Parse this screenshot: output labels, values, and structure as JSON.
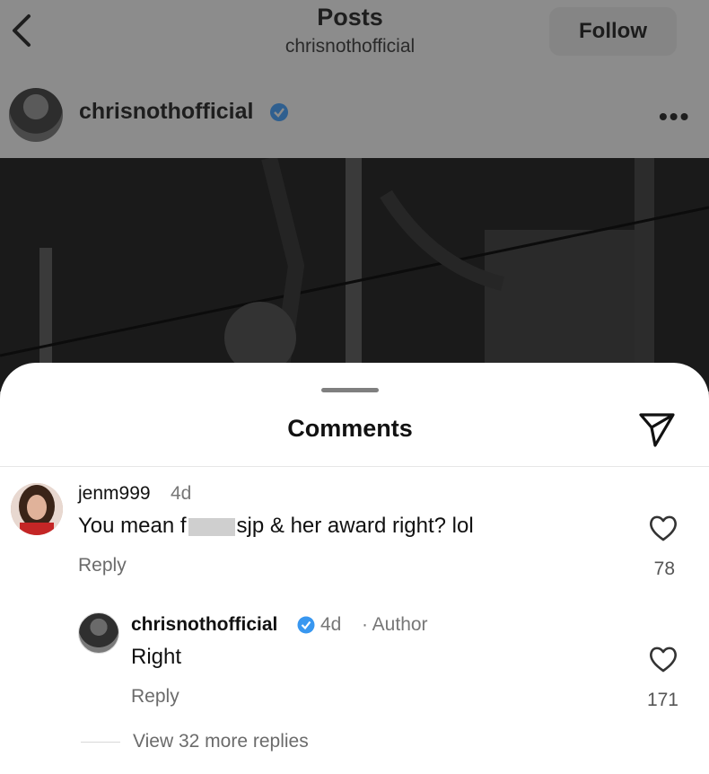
{
  "header": {
    "title": "Posts",
    "subtitle": "chrisnothofficial",
    "follow_label": "Follow"
  },
  "post": {
    "username": "chrisnothofficial"
  },
  "comments_sheet": {
    "title": "Comments",
    "comments": [
      {
        "username": "jenm999",
        "time": "4d",
        "text_before": "You mean f",
        "text_after": "sjp & her award right? lol",
        "reply_label": "Reply",
        "likes": "78"
      },
      {
        "username": "chrisnothofficial",
        "time": "4d",
        "author_tag": "· Author",
        "text": "Right",
        "reply_label": "Reply",
        "likes": "171"
      }
    ],
    "view_more_replies": "View 32 more replies"
  },
  "colors": {
    "verified_blue": "#3897f0",
    "dim_overlay": "#8c8c8c"
  },
  "icons": [
    "back-chevron-icon",
    "verified-badge-icon",
    "more-options-icon",
    "share-send-icon",
    "heart-icon"
  ]
}
